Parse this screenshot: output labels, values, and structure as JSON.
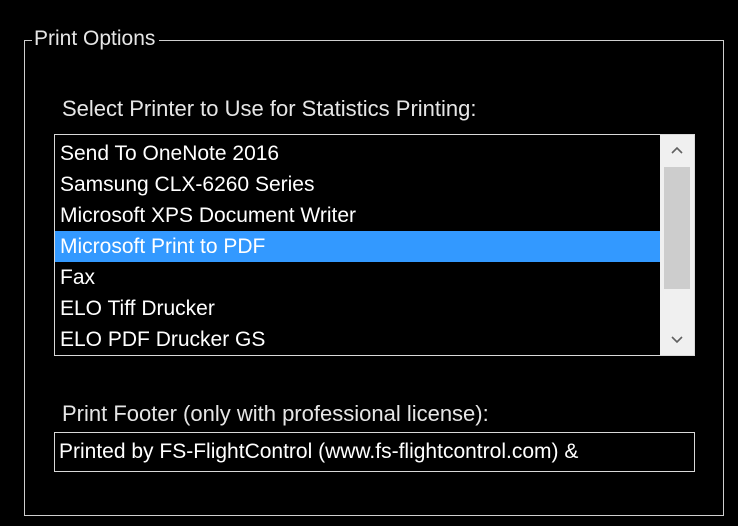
{
  "group": {
    "title": "Print Options"
  },
  "printer": {
    "label": "Select Printer to Use for Statistics Printing:",
    "items": [
      {
        "label": "Send To OneNote 2016",
        "selected": false
      },
      {
        "label": "Samsung CLX-6260 Series",
        "selected": false
      },
      {
        "label": "Microsoft XPS Document Writer",
        "selected": false
      },
      {
        "label": "Microsoft Print to PDF",
        "selected": true
      },
      {
        "label": "Fax",
        "selected": false
      },
      {
        "label": "ELO Tiff Drucker",
        "selected": false
      },
      {
        "label": "ELO PDF Drucker GS",
        "selected": false
      }
    ],
    "selected_color": "#3399ff"
  },
  "footer": {
    "label": "Print Footer (only with professional license):",
    "value": "Printed by FS-FlightControl (www.fs-flightcontrol.com) & "
  },
  "icons": {
    "scroll_up": "chevron-up-icon",
    "scroll_down": "chevron-down-icon"
  }
}
